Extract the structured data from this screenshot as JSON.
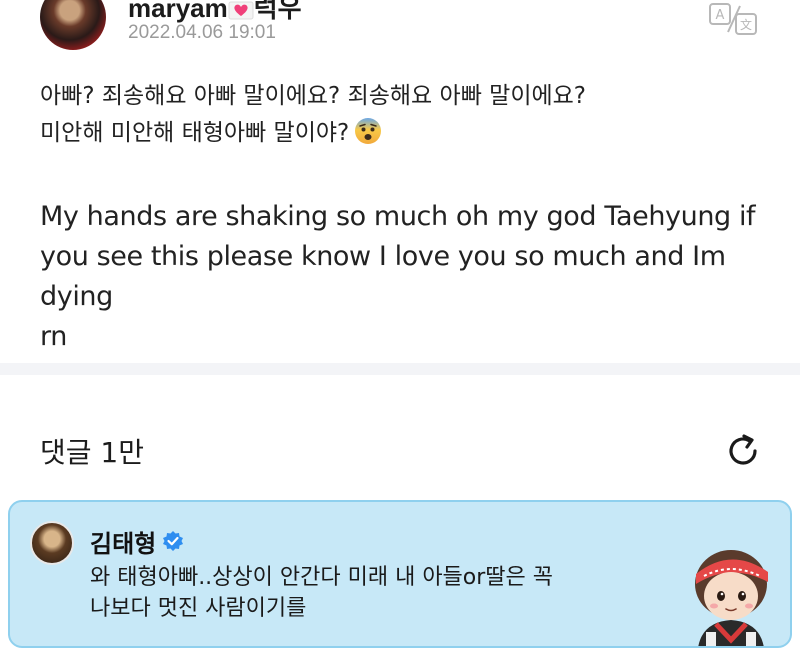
{
  "post": {
    "author": "maryam",
    "author_suffix": "럭우",
    "timestamp": "2022.04.06 19:01",
    "translate_icon": "translate-icon",
    "korean_lines": [
      "아빠?  죄송해요 아빠 말이에요?  죄송해요 아빠 말이에요?",
      "미안해 미안해 태형아빠 말이야?"
    ],
    "emoji": "anxious-face-emoji",
    "english_lines": [
      "My hands are shaking so much oh my god Taehyung if",
      "you see this please know I love you so much and Im dying",
      "rn"
    ]
  },
  "comments": {
    "count_label": "댓글 1만",
    "refresh_icon": "refresh-icon"
  },
  "pinned_comment": {
    "name": "김태형",
    "verified_icon": "verified-badge-icon",
    "lines": [
      "와 태형아빠..상상이 안간다 미래 내 아들or딸은 꼭",
      "나보다 멋진 사람이기를"
    ],
    "colors": {
      "background": "#c7e8f7",
      "border": "#8fd0ee",
      "verified": "#2f8ef0"
    }
  }
}
